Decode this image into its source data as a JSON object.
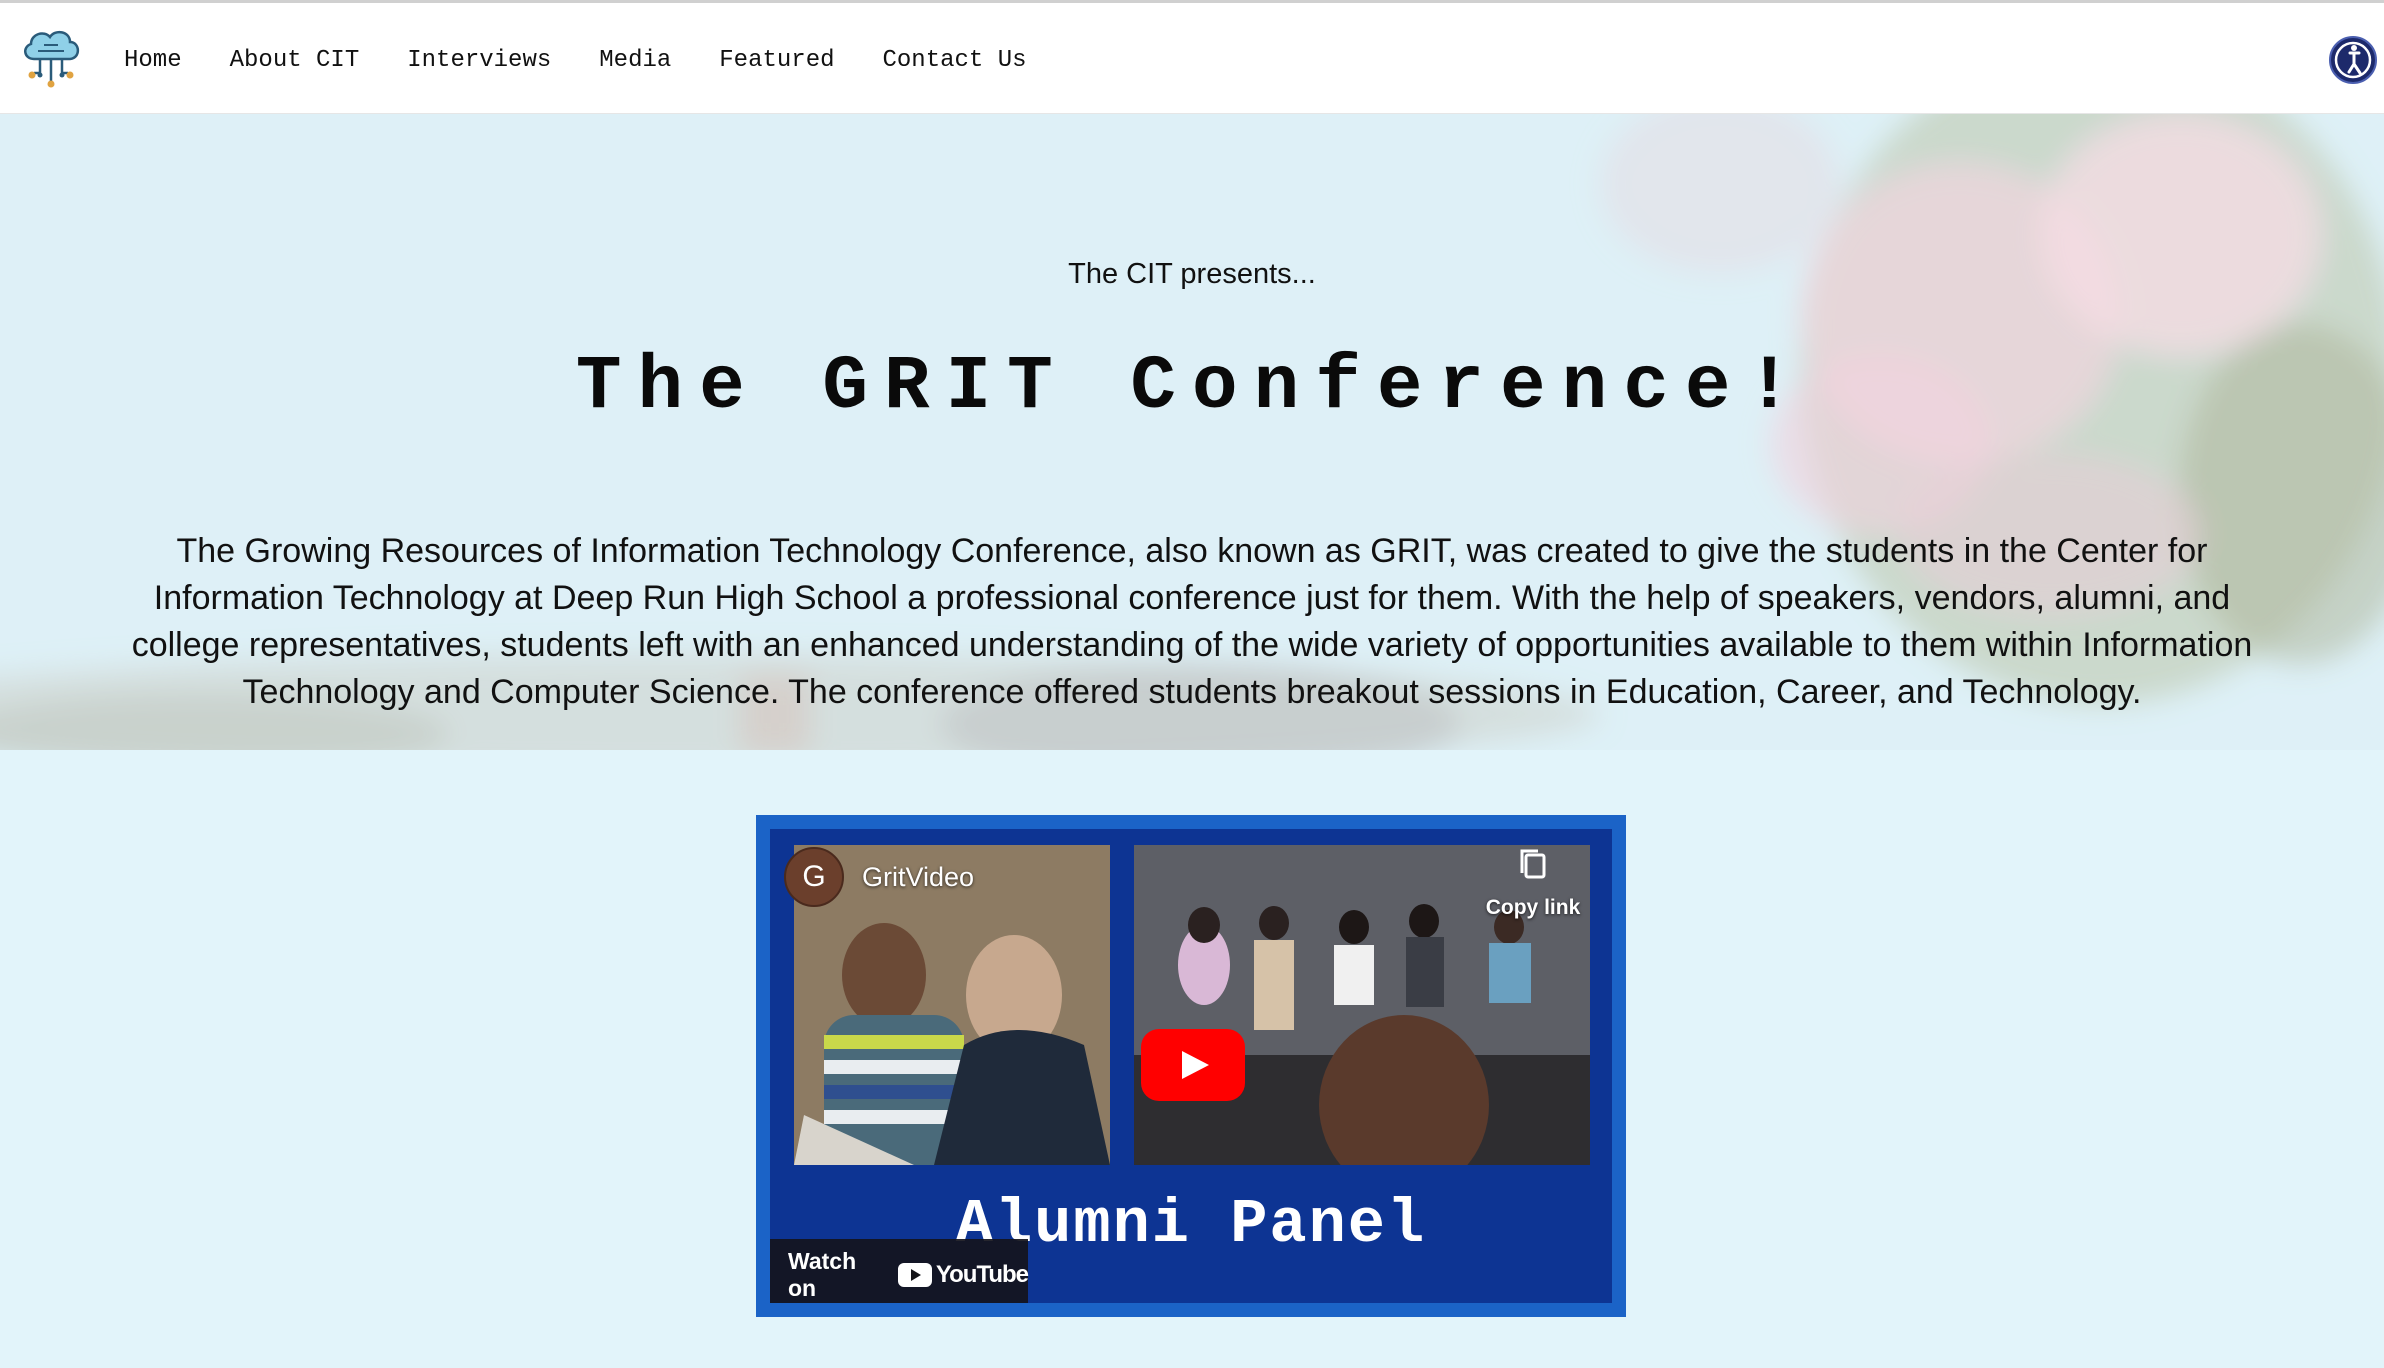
{
  "nav": {
    "logo_icon": "cloud-circuit-icon",
    "links": [
      "Home",
      "About CIT",
      "Interviews",
      "Media",
      "Featured",
      "Contact Us"
    ],
    "accessibility_icon": "accessibility-icon"
  },
  "hero": {
    "pretitle": "The CIT presents...",
    "title": "The GRIT Conference!",
    "description": "The Growing Resources of Information Technology Conference, also known as GRIT, was created to give the students in the Center for Information Technology at Deep Run High School a professional conference just for them. With the help of speakers, vendors, alumni, and college representatives, students left with an enhanced understanding of the wide variety of opportunities available to them within Information Technology and Computer Science. The conference offered students breakout sessions in Education, Career, and Technology."
  },
  "video": {
    "channel_avatar_letter": "G",
    "channel_name": "GritVideo",
    "copy_link_label": "Copy link",
    "title_overlay": "Alumni Panel",
    "watch_on_label": "Watch on",
    "youtube_wordmark": "YouTube",
    "colors": {
      "frame": "#1b63c7",
      "background": "#0d3493",
      "play": "#ff0000"
    }
  }
}
